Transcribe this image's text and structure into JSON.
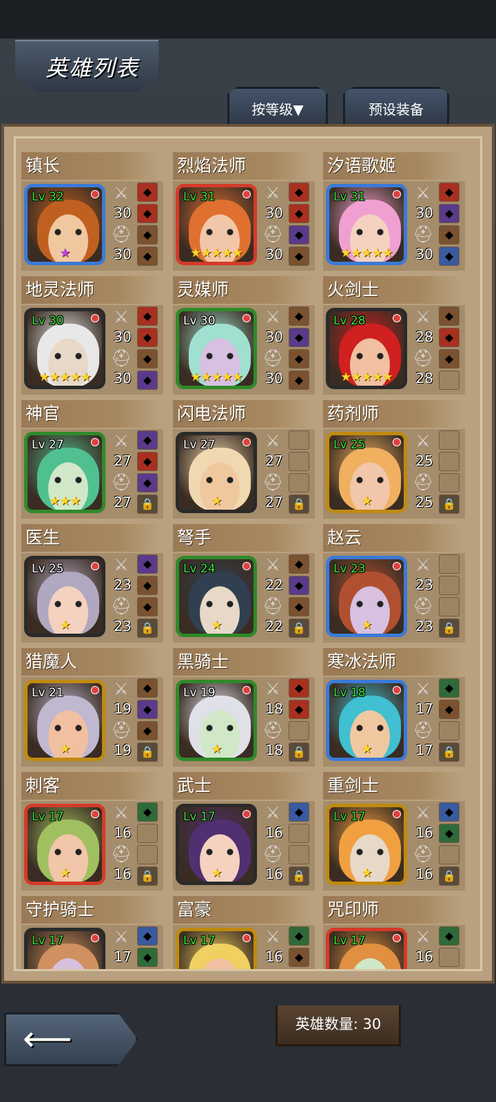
{
  "header": {
    "title": "英雄列表"
  },
  "tabs": {
    "sort_label": "按等级▼",
    "preset_label": "预设装备"
  },
  "footer": {
    "hero_count_label": "英雄数量: 30"
  },
  "heroes": [
    {
      "name": "镇长",
      "level": "Lv 32",
      "atk": "30",
      "def": "30",
      "stars": 1,
      "star_color": "purple",
      "frame": "#3a7ad8",
      "lv_green": true
    },
    {
      "name": "烈焰法师",
      "level": "Lv 31",
      "atk": "30",
      "def": "30",
      "stars": 5,
      "frame": "#d43a2a",
      "lv_green": true
    },
    {
      "name": "汐语歌姬",
      "level": "Lv 31",
      "atk": "30",
      "def": "30",
      "stars": 5,
      "frame": "#3a7ad8",
      "lv_green": true
    },
    {
      "name": "地灵法师",
      "level": "Lv 30",
      "atk": "30",
      "def": "30",
      "stars": 5,
      "frame": "#2a2a2a",
      "lv_green": true
    },
    {
      "name": "灵媒师",
      "level": "Lv 30",
      "atk": "30",
      "def": "30",
      "stars": 5,
      "frame": "#2f8a2a",
      "lv_green": false
    },
    {
      "name": "火剑士",
      "level": "Lv 28",
      "atk": "28",
      "def": "28",
      "stars": 5,
      "frame": "#2a2a2a",
      "lv_green": true
    },
    {
      "name": "神官",
      "level": "Lv 27",
      "atk": "27",
      "def": "27",
      "stars": 3,
      "frame": "#2f8a2a",
      "lv_green": false
    },
    {
      "name": "闪电法师",
      "level": "Lv 27",
      "atk": "27",
      "def": "27",
      "stars": 1,
      "frame": "#2a2a2a",
      "lv_green": false
    },
    {
      "name": "药剂师",
      "level": "Lv 25",
      "atk": "25",
      "def": "25",
      "stars": 1,
      "frame": "#c08a10",
      "lv_green": true
    },
    {
      "name": "医生",
      "level": "Lv 25",
      "atk": "23",
      "def": "23",
      "stars": 1,
      "frame": "#2a2a2a",
      "lv_green": false
    },
    {
      "name": "弩手",
      "level": "Lv 24",
      "atk": "22",
      "def": "22",
      "stars": 1,
      "frame": "#2f8a2a",
      "lv_green": true
    },
    {
      "name": "赵云",
      "level": "Lv 23",
      "atk": "23",
      "def": "23",
      "stars": 1,
      "frame": "#3a7ad8",
      "lv_green": true
    },
    {
      "name": "猎魔人",
      "level": "Lv 21",
      "atk": "19",
      "def": "19",
      "stars": 1,
      "frame": "#c08a10",
      "lv_green": false
    },
    {
      "name": "黑骑士",
      "level": "Lv 19",
      "atk": "18",
      "def": "18",
      "stars": 1,
      "frame": "#2f8a2a",
      "lv_green": false
    },
    {
      "name": "寒冰法师",
      "level": "Lv 18",
      "atk": "17",
      "def": "17",
      "stars": 1,
      "frame": "#3a7ad8",
      "lv_green": true
    },
    {
      "name": "刺客",
      "level": "Lv 17",
      "atk": "16",
      "def": "16",
      "stars": 1,
      "frame": "#d43a2a",
      "lv_green": true
    },
    {
      "name": "武士",
      "level": "Lv 17",
      "atk": "16",
      "def": "16",
      "stars": 1,
      "frame": "#2a2a2a",
      "lv_green": true
    },
    {
      "name": "重剑士",
      "level": "Lv 17",
      "atk": "16",
      "def": "16",
      "stars": 1,
      "frame": "#c08a10",
      "lv_green": true
    },
    {
      "name": "守护骑士",
      "level": "Lv 17",
      "atk": "17",
      "def": "",
      "stars": 0,
      "frame": "#2a2a2a",
      "lv_green": true
    },
    {
      "name": "富豪",
      "level": "Lv 17",
      "atk": "16",
      "def": "",
      "stars": 0,
      "frame": "#c08a10",
      "lv_green": true
    },
    {
      "name": "咒印师",
      "level": "Lv 17",
      "atk": "16",
      "def": "",
      "stars": 0,
      "frame": "#d43a2a",
      "lv_green": true
    }
  ],
  "slots": [
    [
      "red",
      "red",
      "brown",
      "brown"
    ],
    [
      "red",
      "red",
      "purple",
      "brown"
    ],
    [
      "red",
      "purple",
      "brown",
      "blue"
    ],
    [
      "red",
      "red",
      "brown",
      "purple"
    ],
    [
      "brown",
      "purple",
      "brown",
      "brown"
    ],
    [
      "brown",
      "red",
      "brown",
      "empty"
    ],
    [
      "purple",
      "red",
      "purple",
      "lock"
    ],
    [
      "empty",
      "empty",
      "empty",
      "lock"
    ],
    [
      "empty",
      "empty",
      "empty",
      "lock"
    ],
    [
      "purple",
      "brown",
      "brown",
      "lock"
    ],
    [
      "brown",
      "purple",
      "brown",
      "lock"
    ],
    [
      "empty",
      "empty",
      "empty",
      "lock"
    ],
    [
      "brown",
      "purple",
      "brown",
      "lock"
    ],
    [
      "red",
      "red",
      "empty",
      "lock"
    ],
    [
      "green",
      "brown",
      "empty",
      "lock"
    ],
    [
      "green",
      "empty",
      "empty",
      "lock"
    ],
    [
      "blue",
      "empty",
      "empty",
      "lock"
    ],
    [
      "blue",
      "green",
      "empty",
      "lock"
    ],
    [
      "blue",
      "green",
      "red",
      "empty"
    ],
    [
      "green",
      "brown",
      "empty",
      "empty"
    ],
    [
      "green",
      "empty",
      "empty",
      "empty"
    ]
  ],
  "icons": {
    "back": "left-arrow-icon",
    "atk": "sword-icon",
    "def": "helmet-icon",
    "lock": "lock-icon",
    "star": "star-icon"
  }
}
